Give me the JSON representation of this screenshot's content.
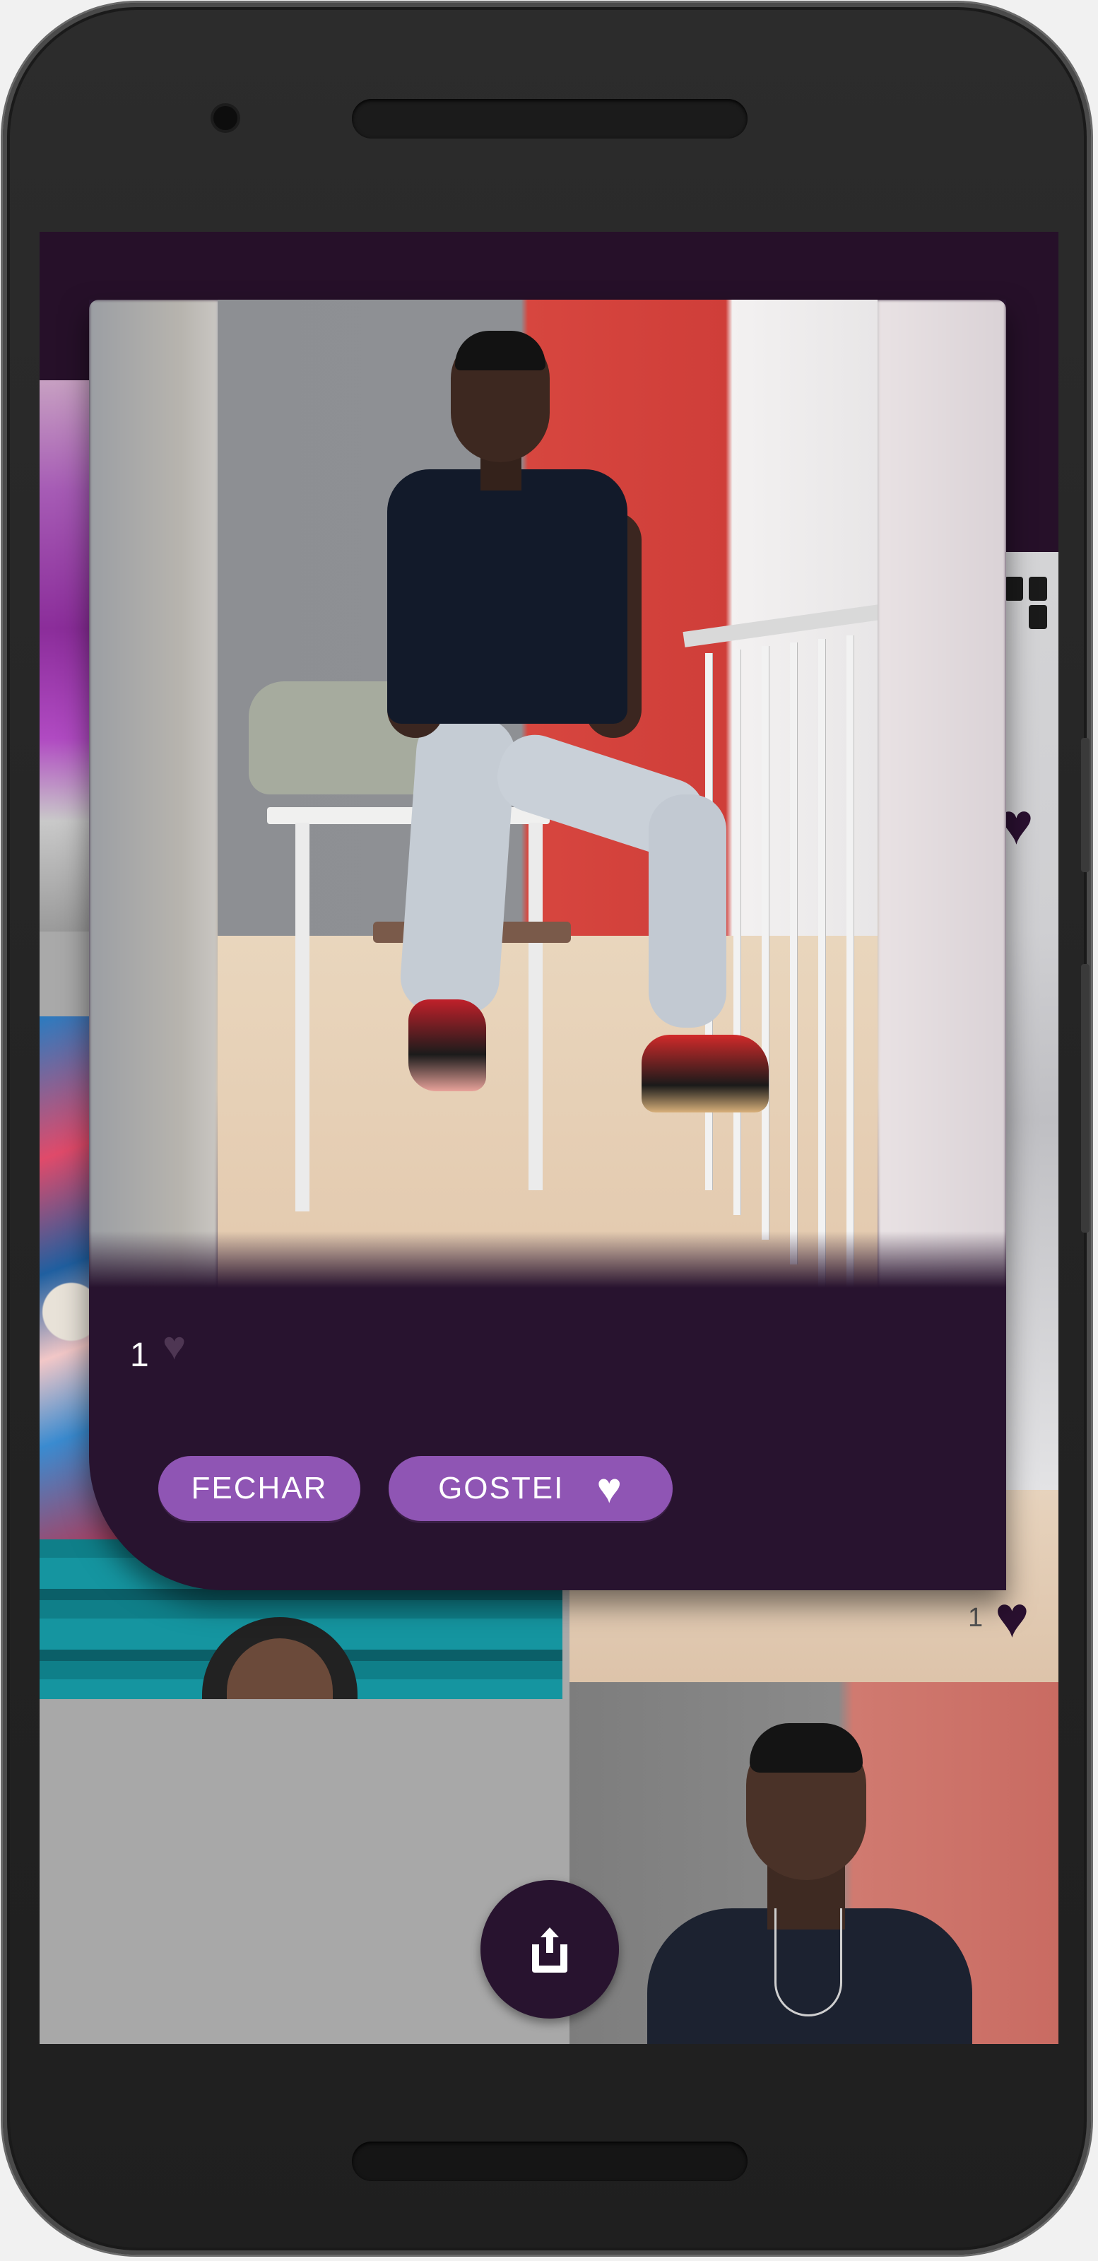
{
  "modal": {
    "likes_count": "1",
    "close_label": "FECHAR",
    "like_label": "GOSTEI"
  },
  "gallery": {
    "tile_likes_count": "1"
  },
  "icons": {
    "heart": "heart-icon",
    "share": "share-icon",
    "grid": "grid-icon"
  },
  "colors": {
    "primary_dark": "#28132f",
    "button": "#8f55b4",
    "text_on_dark": "#ffffff"
  }
}
